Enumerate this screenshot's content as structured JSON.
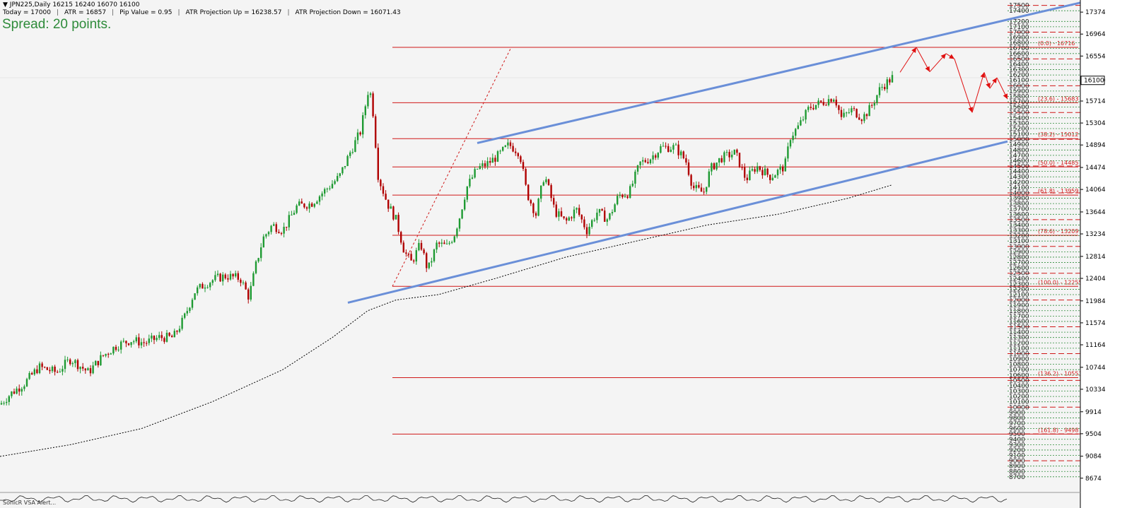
{
  "header": {
    "symbol": "JPN225,Daily",
    "ohlc": "16215 16240 16070 16100",
    "stats": [
      "Today = 17000",
      "ATR = 16857",
      "Pip Value = 0.95",
      "ATR Projection Up = 16238.57",
      "ATR Projection Down = 16071.43"
    ],
    "spread": "Spread: 20 points."
  },
  "indicator_label": "SonicR VSA  Alert...",
  "colors": {
    "background": "#f4f4f4",
    "bull_candle": "#1e9a32",
    "bear_candle": "#b00000",
    "fib_line": "#d01818",
    "channel": "#6a8fd8",
    "ma": "#000000",
    "arrow": "#e01010",
    "level_dash": "#d01818"
  },
  "chart_data": {
    "type": "candlestick",
    "title": "JPN225,Daily",
    "ylim": [
      8500,
      17600
    ],
    "price_label": "16100",
    "axis_ticks": [
      17374,
      16964,
      16554,
      16100,
      15714,
      15304,
      14894,
      14474,
      14064,
      13644,
      13234,
      12814,
      12404,
      11984,
      11574,
      11164,
      10744,
      10334,
      9914,
      9504,
      9084,
      8674
    ],
    "fibonacci": [
      {
        "label": "(0.0) - 16716",
        "value": 16716
      },
      {
        "label": "(23.6) - 15683",
        "value": 15683
      },
      {
        "label": "(38.2) - 15012",
        "value": 15012
      },
      {
        "label": "(50.0) - 14485",
        "value": 14485
      },
      {
        "label": "(61.8) - 13959",
        "value": 13959
      },
      {
        "label": "(78.6) - 13209",
        "value": 13209
      },
      {
        "label": "(100.0) - 12255",
        "value": 12255
      },
      {
        "label": "(136.2) - 10551",
        "value": 10551
      },
      {
        "label": "(161.8) - 9498",
        "value": 9498
      }
    ],
    "scale_levels": [
      17500,
      17400,
      17200,
      17100,
      17000,
      16900,
      16800,
      16700,
      16600,
      16500,
      16400,
      16300,
      16200,
      16100,
      16000,
      15900,
      15800,
      15700,
      15600,
      15500,
      15400,
      15300,
      15200,
      15100,
      15000,
      14900,
      14800,
      14700,
      14600,
      14500,
      14400,
      14300,
      14200,
      14100,
      14000,
      13900,
      13800,
      13700,
      13600,
      13500,
      13400,
      13300,
      13200,
      13100,
      13000,
      12900,
      12800,
      12700,
      12600,
      12500,
      12400,
      12300,
      12200,
      12100,
      12000,
      11900,
      11800,
      11700,
      11600,
      11500,
      11400,
      11300,
      11200,
      11100,
      11000,
      10900,
      10800,
      10700,
      10600,
      10500,
      10400,
      10300,
      10200,
      10100,
      10000,
      9900,
      9800,
      9700,
      9600,
      9500,
      9400,
      9300,
      9200,
      9100,
      9000,
      8900,
      8800,
      8700
    ],
    "candle_path": [
      [
        0,
        10050
      ],
      [
        15,
        10250
      ],
      [
        35,
        10450
      ],
      [
        55,
        10750
      ],
      [
        80,
        10650
      ],
      [
        100,
        10900
      ],
      [
        125,
        10650
      ],
      [
        145,
        10950
      ],
      [
        165,
        11150
      ],
      [
        185,
        11250
      ],
      [
        205,
        11200
      ],
      [
        225,
        11300
      ],
      [
        245,
        11300
      ],
      [
        260,
        11650
      ],
      [
        275,
        12150
      ],
      [
        290,
        12300
      ],
      [
        305,
        12400
      ],
      [
        320,
        12450
      ],
      [
        340,
        12400
      ],
      [
        352,
        12050
      ],
      [
        362,
        12650
      ],
      [
        372,
        13150
      ],
      [
        385,
        13400
      ],
      [
        400,
        13300
      ],
      [
        420,
        13750
      ],
      [
        440,
        13800
      ],
      [
        460,
        14050
      ],
      [
        480,
        14300
      ],
      [
        495,
        14750
      ],
      [
        510,
        15150
      ],
      [
        522,
        16000
      ],
      [
        527,
        15600
      ],
      [
        535,
        14300
      ],
      [
        548,
        13800
      ],
      [
        560,
        13500
      ],
      [
        572,
        12900
      ],
      [
        582,
        12700
      ],
      [
        595,
        13050
      ],
      [
        605,
        12550
      ],
      [
        618,
        13050
      ],
      [
        632,
        13000
      ],
      [
        642,
        13200
      ],
      [
        650,
        13550
      ],
      [
        660,
        14100
      ],
      [
        675,
        14450
      ],
      [
        690,
        14550
      ],
      [
        705,
        14700
      ],
      [
        720,
        14900
      ],
      [
        735,
        14750
      ],
      [
        745,
        14000
      ],
      [
        758,
        13600
      ],
      [
        770,
        14350
      ],
      [
        785,
        13650
      ],
      [
        800,
        13450
      ],
      [
        815,
        13700
      ],
      [
        830,
        13300
      ],
      [
        845,
        13650
      ],
      [
        860,
        13500
      ],
      [
        875,
        13950
      ],
      [
        890,
        14000
      ],
      [
        905,
        14550
      ],
      [
        920,
        14650
      ],
      [
        935,
        14850
      ],
      [
        955,
        14850
      ],
      [
        970,
        14600
      ],
      [
        980,
        14100
      ],
      [
        995,
        14000
      ],
      [
        1005,
        14450
      ],
      [
        1020,
        14650
      ],
      [
        1040,
        14750
      ],
      [
        1055,
        14250
      ],
      [
        1070,
        14500
      ],
      [
        1090,
        14300
      ],
      [
        1110,
        14500
      ],
      [
        1118,
        15050
      ],
      [
        1130,
        15250
      ],
      [
        1145,
        15600
      ],
      [
        1165,
        15700
      ],
      [
        1180,
        15800
      ],
      [
        1190,
        15400
      ],
      [
        1205,
        15550
      ],
      [
        1220,
        15400
      ],
      [
        1232,
        15600
      ],
      [
        1245,
        15950
      ],
      [
        1262,
        16150
      ]
    ],
    "ma_path": [
      [
        0,
        9080
      ],
      [
        100,
        9300
      ],
      [
        200,
        9600
      ],
      [
        300,
        10100
      ],
      [
        400,
        10700
      ],
      [
        470,
        11300
      ],
      [
        520,
        11800
      ],
      [
        560,
        12000
      ],
      [
        620,
        12100
      ],
      [
        700,
        12400
      ],
      [
        800,
        12800
      ],
      [
        900,
        13100
      ],
      [
        1000,
        13400
      ],
      [
        1100,
        13600
      ],
      [
        1200,
        13900
      ],
      [
        1262,
        14150
      ]
    ],
    "channel_upper": [
      [
        675,
        14930
      ],
      [
        1528,
        17550
      ]
    ],
    "channel_lower": [
      [
        492,
        11950
      ],
      [
        1425,
        14960
      ]
    ],
    "channel_base": [
      [
        492,
        11950
      ],
      [
        1425,
        14960
      ]
    ],
    "fib_swing": [
      [
        555,
        12255
      ],
      [
        723,
        16716
      ]
    ],
    "projection_arrows": [
      [
        1273,
        16250
      ],
      [
        1296,
        16716
      ],
      [
        1315,
        16260
      ],
      [
        1338,
        16600
      ],
      [
        1350,
        16500
      ],
      [
        1375,
        15500
      ],
      [
        1392,
        16250
      ],
      [
        1400,
        15950
      ],
      [
        1410,
        16150
      ],
      [
        1425,
        15750
      ]
    ]
  }
}
